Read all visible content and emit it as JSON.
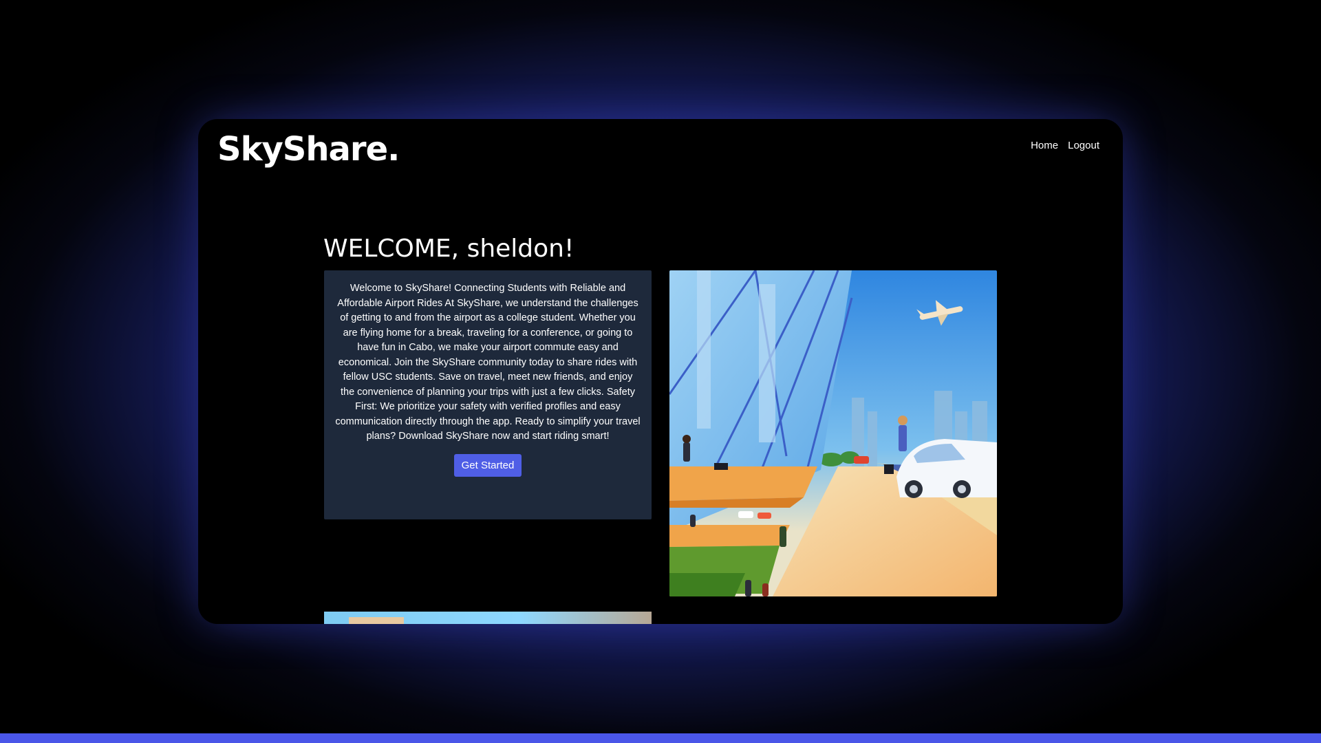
{
  "app": {
    "logo": "SkyShare."
  },
  "nav": {
    "home_label": "Home",
    "logout_label": "Logout"
  },
  "main": {
    "heading": "WELCOME, sheldon!",
    "intro_text": "Welcome to SkyShare! Connecting Students with Reliable and Affordable Airport Rides At SkyShare, we understand the challenges of getting to and from the airport as a college student. Whether you are flying home for a break, traveling for a conference, or going to have fun in Cabo, we make your airport commute easy and economical. Join the SkyShare community today to share rides with fellow USC students. Save on travel, meet new friends, and enjoy the convenience of planning your trips with just a few clicks. Safety First: We prioritize your safety with verified profiles and easy communication directly through the app. Ready to simplify your travel plans? Download SkyShare now and start riding smart!",
    "cta_label": "Get Started"
  },
  "colors": {
    "accent": "#4f5ee6",
    "card_background": "#1e293b",
    "window_background": "#000000"
  }
}
